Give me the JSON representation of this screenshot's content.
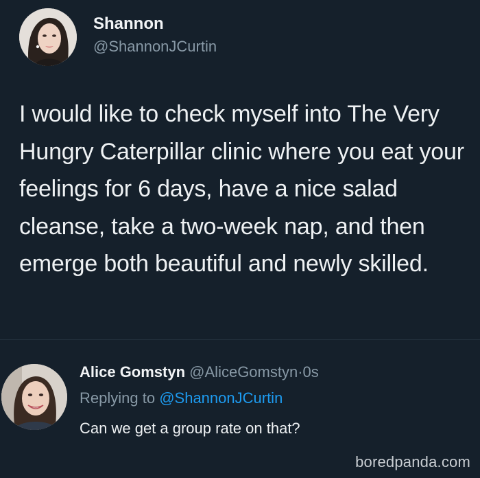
{
  "tweet": {
    "author": {
      "name": "Shannon",
      "handle": "@ShannonJCurtin"
    },
    "text": "I would like to check myself into The Very Hungry Caterpillar clinic where you eat your feelings for 6 days, have a nice salad cleanse, take a two-week nap, and then emerge both beautiful and newly skilled."
  },
  "reply": {
    "author": {
      "name": "Alice Gomstyn",
      "handle": "@AliceGomstyn",
      "separator": "·",
      "time": "0s"
    },
    "replying_prefix": "Replying to",
    "replying_handle": "@ShannonJCurtin",
    "text": "Can we get a group rate on that?"
  },
  "watermark": "boredpanda.com",
  "colors": {
    "background": "#15202b",
    "text": "#eef1f3",
    "secondary_text": "#8899a6",
    "link": "#1d9bf0"
  },
  "icons": {
    "main_avatar": "avatar-photo-woman-dark-hair",
    "reply_avatar": "avatar-photo-woman-smiling"
  }
}
